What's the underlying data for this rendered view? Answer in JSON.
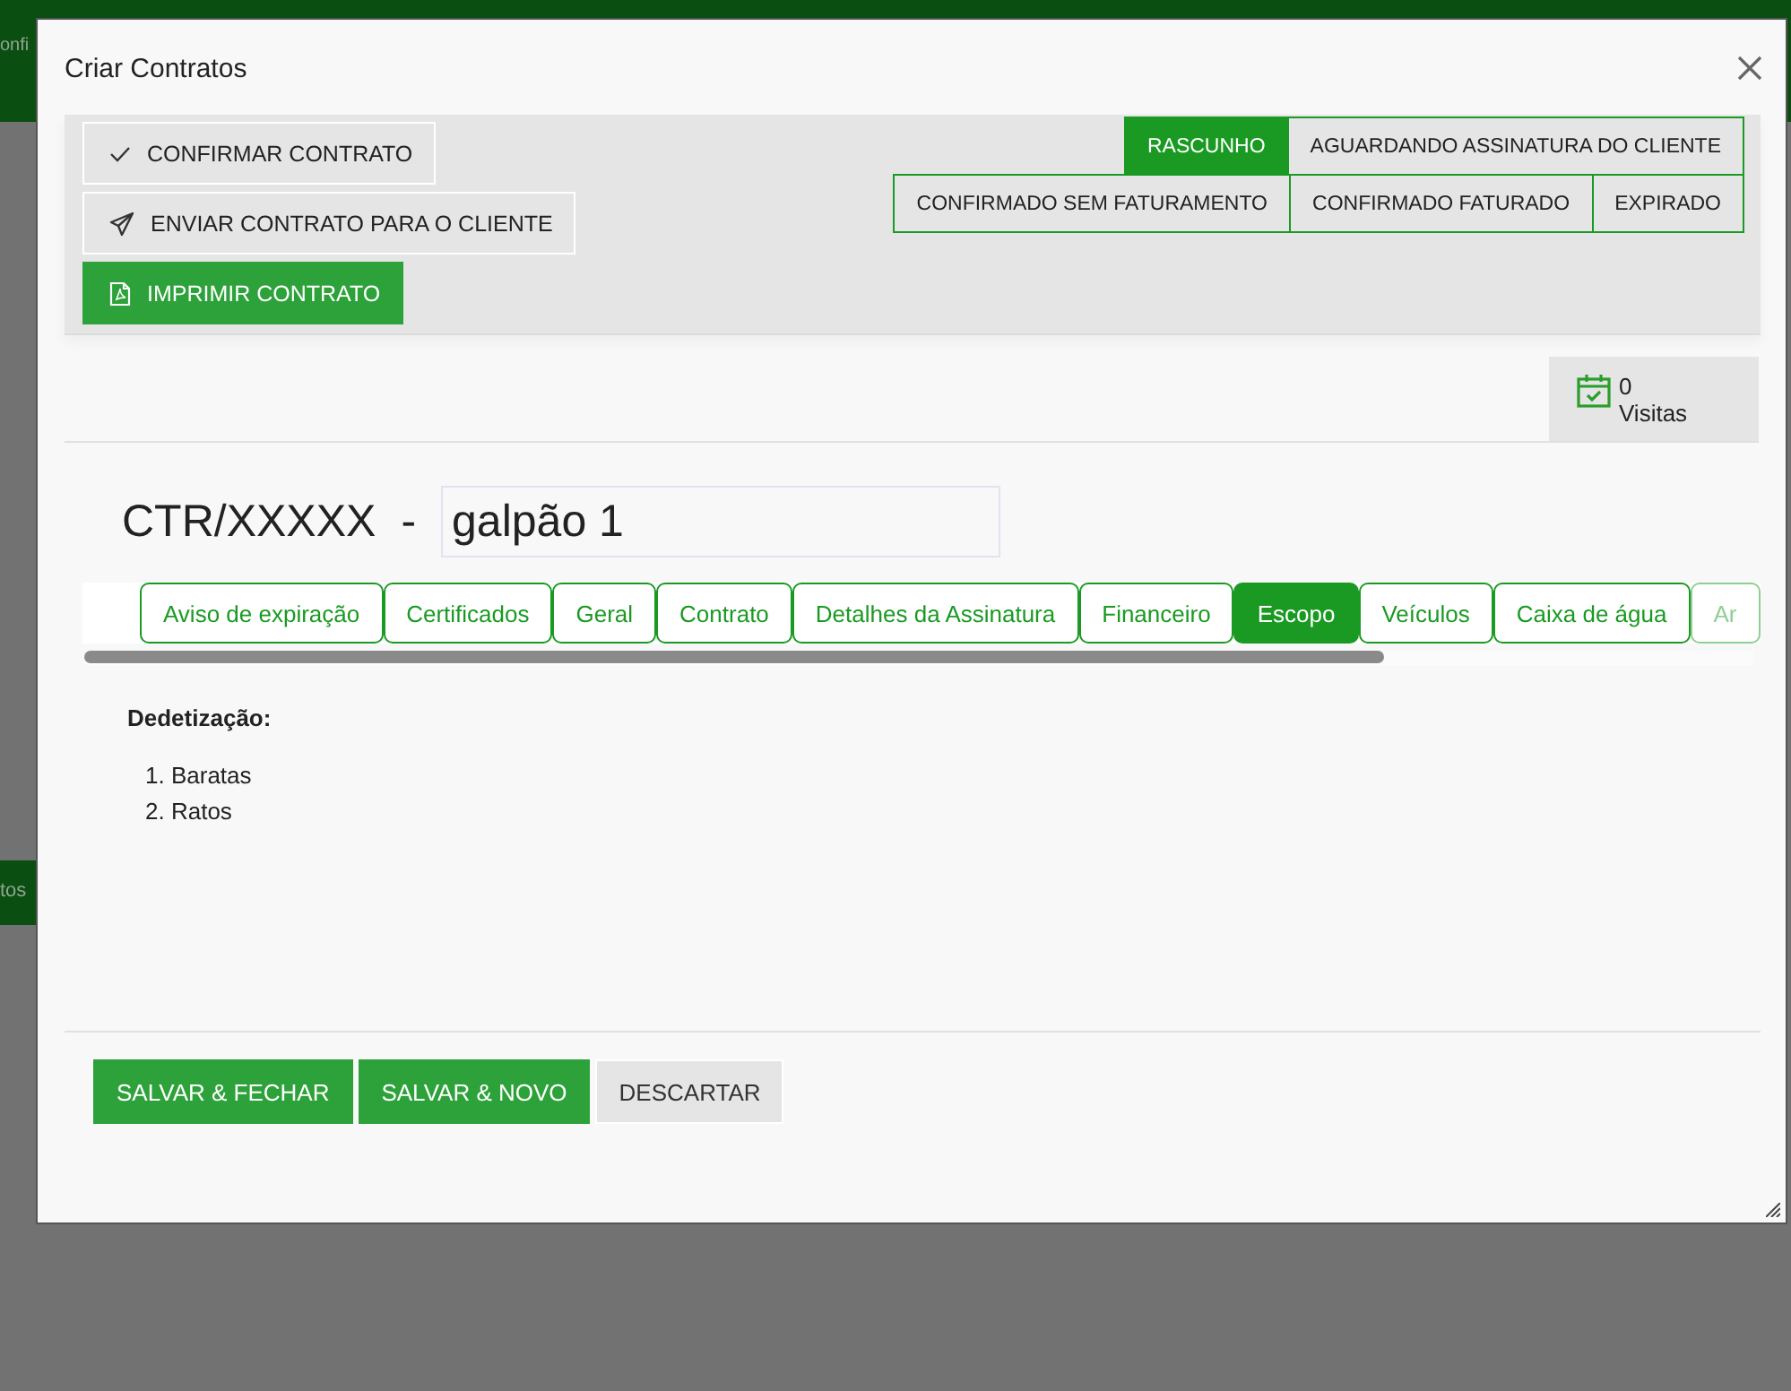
{
  "background": {
    "header_text": "onfi",
    "bar_text": "tos"
  },
  "dialog": {
    "title": "Criar Contratos"
  },
  "actions": [
    {
      "label": "CONFIRMAR CONTRATO",
      "kind": "check",
      "primary": false
    },
    {
      "label": "ENVIAR CONTRATO PARA O CLIENTE",
      "kind": "send",
      "primary": false
    },
    {
      "label": "IMPRIMIR CONTRATO",
      "kind": "pdf",
      "primary": true
    }
  ],
  "statuses": [
    [
      {
        "label": "RASCUNHO",
        "selected": true
      },
      {
        "label": "AGUARDANDO ASSINATURA DO CLIENTE",
        "selected": false
      }
    ],
    [
      {
        "label": "CONFIRMADO SEM FATURAMENTO",
        "selected": false
      },
      {
        "label": "CONFIRMADO FATURADO",
        "selected": false
      },
      {
        "label": "EXPIRADO",
        "selected": false
      }
    ]
  ],
  "visits": {
    "count": "0",
    "label": "Visitas"
  },
  "contract": {
    "code": "CTR/XXXXX",
    "separator": "-",
    "name": "galpão 1"
  },
  "tabs": [
    {
      "label": "Aviso de expiração",
      "selected": false
    },
    {
      "label": "Certificados",
      "selected": false
    },
    {
      "label": "Geral",
      "selected": false
    },
    {
      "label": "Contrato",
      "selected": false
    },
    {
      "label": "Detalhes da Assinatura",
      "selected": false
    },
    {
      "label": "Financeiro",
      "selected": false
    },
    {
      "label": "Escopo",
      "selected": true
    },
    {
      "label": "Veículos",
      "selected": false
    },
    {
      "label": "Caixa de água",
      "selected": false
    },
    {
      "label": "Ar",
      "selected": false
    }
  ],
  "scope": {
    "heading": "Dedetização:",
    "items": [
      {
        "number": "1.",
        "text": "Baratas"
      },
      {
        "number": "2.",
        "text": "Ratos"
      }
    ]
  },
  "footer_buttons": [
    {
      "label": "SALVAR & FECHAR",
      "kind": "primary"
    },
    {
      "label": "SALVAR & NOVO",
      "kind": "primary"
    },
    {
      "label": "DESCARTAR",
      "kind": "secondary"
    }
  ]
}
